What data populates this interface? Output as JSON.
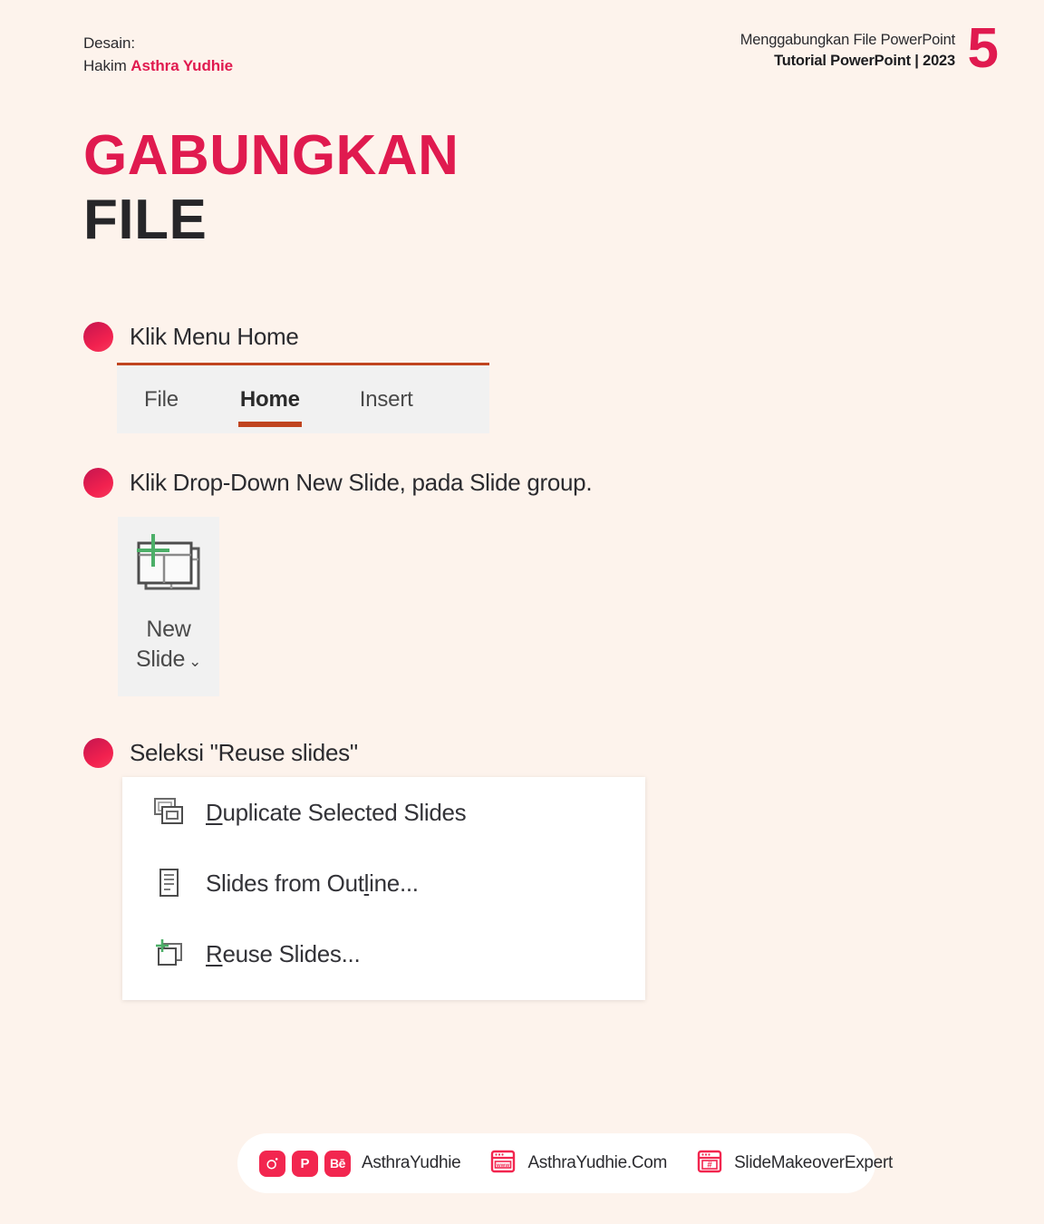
{
  "header": {
    "designer_label": "Desain:",
    "designer_name_prefix": "Hakim ",
    "designer_name": "Asthra Yudhie",
    "topic": "Menggabungkan File PowerPoint",
    "series": "Tutorial PowerPoint | 2023",
    "page_number": "5"
  },
  "title": {
    "line1": "GABUNGKAN",
    "line2": "FILE"
  },
  "steps": [
    {
      "label": "Klik Menu Home"
    },
    {
      "label": "Klik Drop-Down New Slide, pada Slide group."
    },
    {
      "label": "Seleksi \"Reuse slides\""
    }
  ],
  "ribbon": {
    "tabs": [
      {
        "label": "File",
        "active": false
      },
      {
        "label": "Home",
        "active": true
      },
      {
        "label": "Insert",
        "active": false
      }
    ]
  },
  "new_slide_button": {
    "line1": "New",
    "line2": "Slide",
    "caret": "⌄"
  },
  "dropdown_menu": {
    "items": [
      {
        "accel": "D",
        "rest": "uplicate Selected Slides",
        "icon": "duplicate-slides-icon"
      },
      {
        "pre": "Slides from Out",
        "accel": "l",
        "rest": "ine...",
        "icon": "slides-from-outline-icon"
      },
      {
        "accel": "R",
        "rest": "euse Slides...",
        "icon": "reuse-slides-icon"
      }
    ]
  },
  "footer": {
    "social_chips": [
      {
        "name": "instagram",
        "glyph": ""
      },
      {
        "name": "pinterest",
        "glyph": "P"
      },
      {
        "name": "behance",
        "glyph": "Bē"
      }
    ],
    "handle": "AsthraYudhie",
    "website": "AsthraYudhie.Com",
    "website_icon_text": "www",
    "hashtag": "SlideMakeoverExpert",
    "hashtag_icon_text": "#"
  },
  "colors": {
    "background": "#fdf3ec",
    "accent_pink": "#e01a4f",
    "accent_chip": "#f2264f",
    "dark_text": "#262629",
    "ribbon_orange": "#c0441f",
    "ribbon_gray": "#f1f1f1",
    "icon_green": "#4caf68"
  }
}
